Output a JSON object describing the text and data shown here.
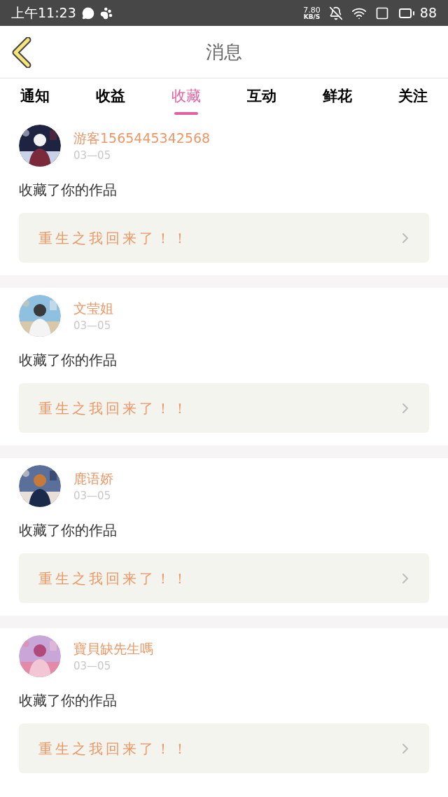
{
  "status_bar": {
    "time": "上午11:23",
    "speed_value": "7.80",
    "speed_unit": "KB/S",
    "battery": "88"
  },
  "header": {
    "title": "消息"
  },
  "tabs": [
    {
      "label": "通知",
      "selected": false
    },
    {
      "label": "收益",
      "selected": false
    },
    {
      "label": "收藏",
      "selected": true
    },
    {
      "label": "互动",
      "selected": false
    },
    {
      "label": "鲜花",
      "selected": false
    },
    {
      "label": "关注",
      "selected": false
    }
  ],
  "messages": [
    {
      "name": "游客1565445342568",
      "date": "03—05",
      "text": "收藏了你的作品",
      "work": "重生之我回来了！！"
    },
    {
      "name": "文莹姐",
      "date": "03—05",
      "text": "收藏了你的作品",
      "work": "重生之我回来了！！"
    },
    {
      "name": "鹿语娇",
      "date": "03—05",
      "text": "收藏了你的作品",
      "work": "重生之我回来了！！"
    },
    {
      "name": "寶貝缺先生嗎",
      "date": "03—05",
      "text": "收藏了你的作品",
      "work": "重生之我回来了！！"
    }
  ]
}
